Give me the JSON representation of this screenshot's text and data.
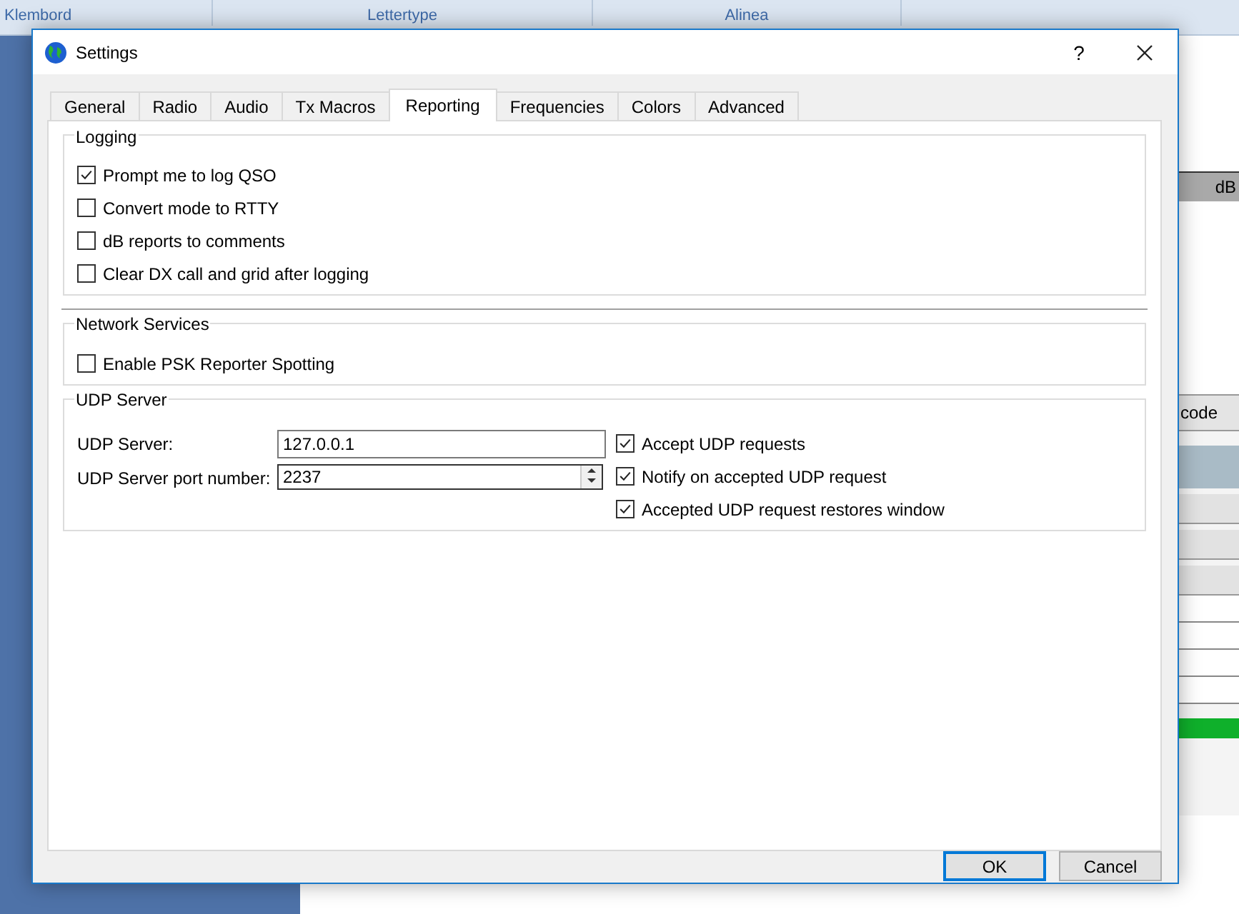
{
  "background": {
    "ribbon_groups": [
      "Klembord",
      "Lettertype",
      "Alinea"
    ],
    "table_headers": [
      "dB",
      "code"
    ]
  },
  "window": {
    "title": "Settings",
    "help": "?"
  },
  "tabs": [
    {
      "label": "General",
      "selected": false
    },
    {
      "label": "Radio",
      "selected": false
    },
    {
      "label": "Audio",
      "selected": false
    },
    {
      "label": "Tx Macros",
      "selected": false
    },
    {
      "label": "Reporting",
      "selected": true
    },
    {
      "label": "Frequencies",
      "selected": false
    },
    {
      "label": "Colors",
      "selected": false
    },
    {
      "label": "Advanced",
      "selected": false
    }
  ],
  "logging": {
    "title": "Logging",
    "options": [
      {
        "label": "Prompt me to log QSO",
        "checked": true
      },
      {
        "label": "Convert mode to RTTY",
        "checked": false
      },
      {
        "label": "dB reports to comments",
        "checked": false
      },
      {
        "label": "Clear DX call and grid after logging",
        "checked": false
      }
    ]
  },
  "network_services": {
    "title": "Network Services",
    "options": [
      {
        "label": "Enable PSK Reporter Spotting",
        "checked": false
      }
    ]
  },
  "udp_server": {
    "title": "UDP Server",
    "server_label": "UDP Server:",
    "server_value": "127.0.0.1",
    "port_label": "UDP Server port number:",
    "port_value": "2237",
    "options": [
      {
        "label": "Accept UDP requests",
        "checked": true
      },
      {
        "label": "Notify on accepted UDP request",
        "checked": true
      },
      {
        "label": "Accepted UDP request restores window",
        "checked": true
      }
    ]
  },
  "buttons": [
    {
      "label": "OK",
      "default": true
    },
    {
      "label": "Cancel",
      "default": false
    }
  ]
}
